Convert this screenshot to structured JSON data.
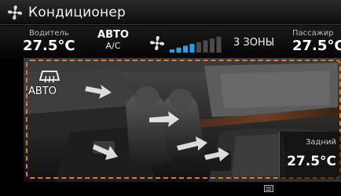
{
  "title": {
    "icon": "fan-icon",
    "text": "Кондиционер"
  },
  "status": {
    "driver_label": "Водитель",
    "driver_temp": "27.5°C",
    "auto_label": "АВТО",
    "ac_label": "A/C",
    "fan_level": 4,
    "fan_levels_total": 8,
    "zones_label": "3 ЗОНЫ",
    "passenger_label": "Пассажир",
    "passenger_temp": "27.5°C"
  },
  "main": {
    "defrost_icon": "rear-defrost-icon",
    "auto_label": "АВТО",
    "rear_label": "Задний",
    "rear_temp": "27.5°C"
  },
  "bottom": {
    "menu_icon": "menu-icon"
  },
  "colors": {
    "frame": "#e07a2a",
    "fan_active": "#2a9ee6",
    "fan_inactive": "#4a4a4a"
  }
}
